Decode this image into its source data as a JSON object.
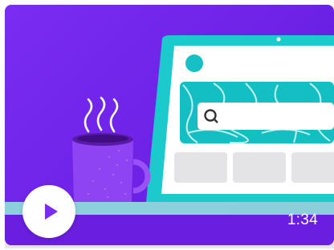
{
  "video": {
    "duration": "1:34"
  },
  "icons": {
    "play": "play-icon",
    "search": "search-icon",
    "mug": "coffee-mug-icon"
  },
  "colors": {
    "background": "#7a2cf2",
    "laptop_frame": "#18c8cc",
    "laptop_screen": "#ffffff",
    "search_banner": "#12c1c4",
    "mug": "#8a3bf0",
    "play_triangle": "#7a2cf2"
  }
}
